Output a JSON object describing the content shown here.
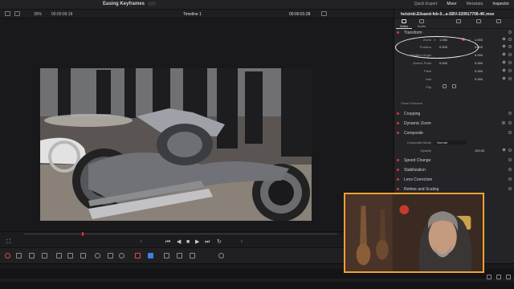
{
  "app": {
    "title": "Easing Keyframes"
  },
  "topbar": {
    "menu": [
      {
        "label": "Quick Export",
        "selected": false
      },
      {
        "label": "Mixer",
        "selected": true
      },
      {
        "label": "Metadata",
        "selected": false
      },
      {
        "label": "Inspector",
        "selected": true
      }
    ]
  },
  "viewer_bar": {
    "zoom": "39%",
    "source_timecode": "00:00:09:18",
    "timeline_name": "Timeline 1",
    "record_timecode": "00:00:01:28"
  },
  "inspector": {
    "clip_name": "helsinki.Elisand-feb-0...a-SBV-320917708-4K.mov",
    "tabs": [
      {
        "label": "Video",
        "active": true
      },
      {
        "label": "Audio",
        "active": false
      },
      {
        "label": "",
        "active": false
      },
      {
        "label": "",
        "active": false
      },
      {
        "label": "",
        "active": false
      }
    ],
    "section_transform": "Transform",
    "zoom_label": "Zoom",
    "zoom_tag_x": "X",
    "zoom_x": "1.050",
    "zoom_tag_y": "Y",
    "zoom_y": "1.000",
    "position_label": "Position",
    "position_x": "0.000",
    "position_y": "0.000",
    "rotation_label": "Rotation Angle",
    "rotation": "0.000",
    "anchor_label": "Anchor Point",
    "anchor_x": "0.000",
    "anchor_y": "0.000",
    "pitch_label": "Pitch",
    "pitch": "0.000",
    "yaw_label": "Yaw",
    "yaw": "0.000",
    "flip_label": "Flip",
    "smart_reframe": "Smart Reframe",
    "sections": [
      "Cropping",
      "Dynamic Zoom",
      "Composite"
    ],
    "composite_mode_label": "Composite Mode",
    "composite_mode": "Normal",
    "opacity_label": "Opacity",
    "opacity": "100.00",
    "sections_after": [
      "Speed Change",
      "Stabilization",
      "Lens Correction",
      "Retime and Scaling"
    ]
  },
  "colors": {
    "accent_red": "#d23a3a",
    "webcam_border": "#f0a233",
    "playhead": "#dd3333"
  },
  "icons": [
    "clip-icon",
    "audio-icon",
    "link-icon",
    "keyframe-icon",
    "reset-icon",
    "play-icon",
    "stop-icon",
    "loop-icon",
    "razor-icon",
    "snap-icon"
  ]
}
